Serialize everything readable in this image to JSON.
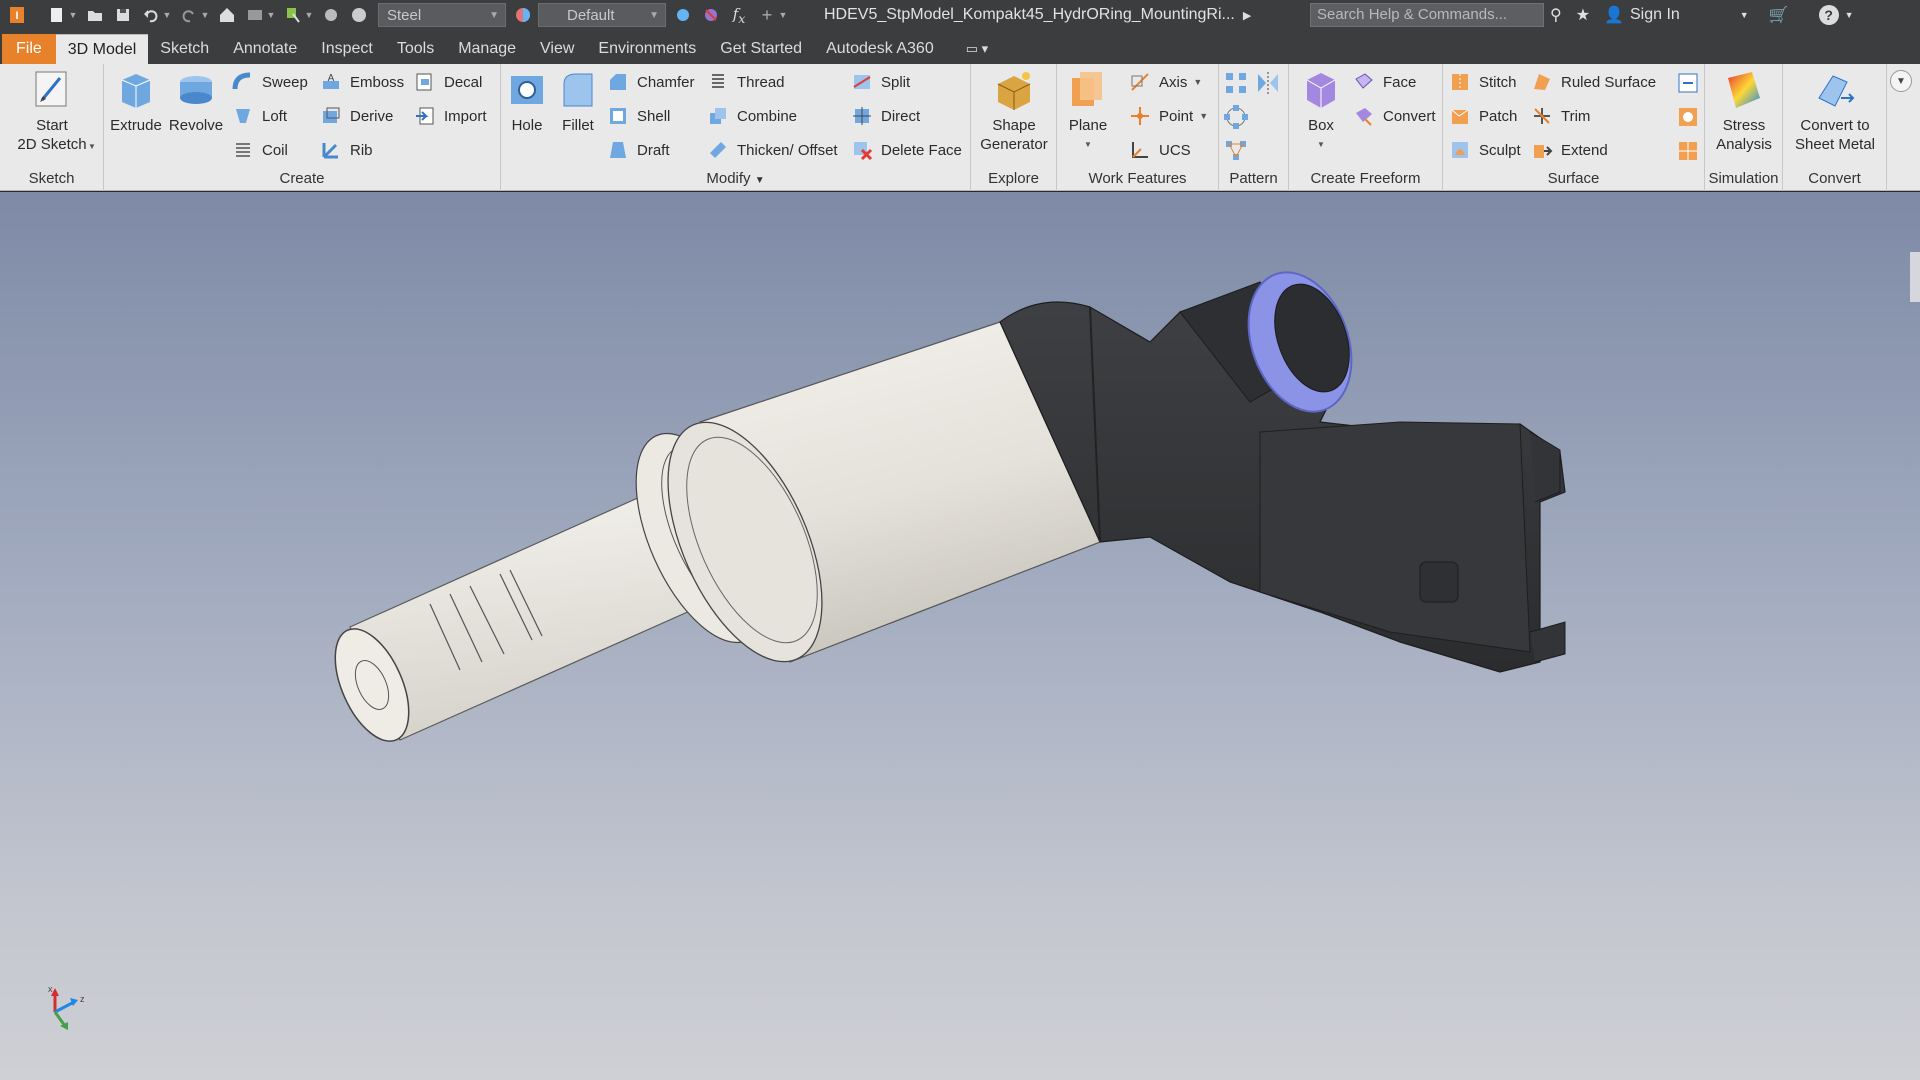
{
  "qat": {
    "material": "Steel",
    "appearance": "Default",
    "doc_title": "HDEV5_StpModel_Kompakt45_HydrORing_MountingRi...",
    "search_placeholder": "Search Help & Commands...",
    "sign_in": "Sign In"
  },
  "tabs": [
    "File",
    "3D Model",
    "Sketch",
    "Annotate",
    "Inspect",
    "Tools",
    "Manage",
    "View",
    "Environments",
    "Get Started",
    "Autodesk A360"
  ],
  "ribbon": {
    "sketch": {
      "title": "Sketch",
      "start_line1": "Start",
      "start_line2": "2D Sketch"
    },
    "create": {
      "title": "Create",
      "extrude": "Extrude",
      "revolve": "Revolve",
      "sweep": "Sweep",
      "loft": "Loft",
      "coil": "Coil",
      "emboss": "Emboss",
      "derive": "Derive",
      "rib": "Rib",
      "decal": "Decal",
      "import": "Import"
    },
    "modify": {
      "title": "Modify",
      "hole": "Hole",
      "fillet": "Fillet",
      "chamfer": "Chamfer",
      "shell": "Shell",
      "draft": "Draft",
      "thread": "Thread",
      "combine": "Combine",
      "thicken": "Thicken/ Offset",
      "split": "Split",
      "direct": "Direct",
      "delete_face": "Delete Face"
    },
    "explore": {
      "title": "Explore",
      "shape_line1": "Shape",
      "shape_line2": "Generator"
    },
    "work": {
      "title": "Work Features",
      "plane": "Plane",
      "axis": "Axis",
      "point": "Point",
      "ucs": "UCS"
    },
    "pattern": {
      "title": "Pattern"
    },
    "freeform": {
      "title": "Create Freeform",
      "box": "Box",
      "face": "Face",
      "convert": "Convert"
    },
    "surface": {
      "title": "Surface",
      "stitch": "Stitch",
      "patch": "Patch",
      "sculpt": "Sculpt",
      "ruled": "Ruled Surface",
      "trim": "Trim",
      "extend": "Extend"
    },
    "simulation": {
      "title": "Simulation",
      "stress_line1": "Stress",
      "stress_line2": "Analysis"
    },
    "convert": {
      "title": "Convert",
      "sm_line1": "Convert to",
      "sm_line2": "Sheet Metal"
    }
  },
  "colors": {
    "accent": "#e8822a",
    "ribbon_bg": "#e9e9ea",
    "dark_bar": "#3c3d3f",
    "model_body": "#e6e3dc",
    "connector": "#3a3b3e",
    "oring": "#8a93e6"
  }
}
